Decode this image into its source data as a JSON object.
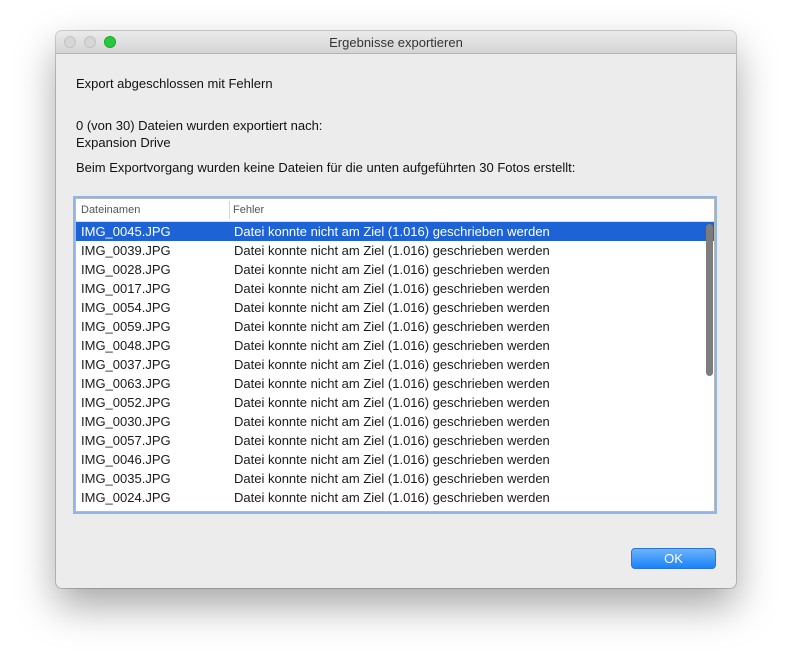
{
  "window": {
    "title": "Ergebnisse exportieren"
  },
  "message": {
    "heading": "Export abgeschlossen mit Fehlern",
    "summary_line1": "0 (von 30) Dateien wurden exportiert nach:",
    "summary_line2": "Expansion Drive",
    "detail": "Beim Exportvorgang wurden keine Dateien für die unten aufgeführten 30 Fotos erstellt:"
  },
  "table": {
    "columns": [
      "Dateinamen",
      "Fehler"
    ],
    "selected_row": 0,
    "rows": [
      {
        "file": "IMG_0045.JPG",
        "error": "Datei konnte nicht am Ziel (1.016) geschrieben werden"
      },
      {
        "file": "IMG_0039.JPG",
        "error": "Datei konnte nicht am Ziel (1.016) geschrieben werden"
      },
      {
        "file": "IMG_0028.JPG",
        "error": "Datei konnte nicht am Ziel (1.016) geschrieben werden"
      },
      {
        "file": "IMG_0017.JPG",
        "error": "Datei konnte nicht am Ziel (1.016) geschrieben werden"
      },
      {
        "file": "IMG_0054.JPG",
        "error": "Datei konnte nicht am Ziel (1.016) geschrieben werden"
      },
      {
        "file": "IMG_0059.JPG",
        "error": "Datei konnte nicht am Ziel (1.016) geschrieben werden"
      },
      {
        "file": "IMG_0048.JPG",
        "error": "Datei konnte nicht am Ziel (1.016) geschrieben werden"
      },
      {
        "file": "IMG_0037.JPG",
        "error": "Datei konnte nicht am Ziel (1.016) geschrieben werden"
      },
      {
        "file": "IMG_0063.JPG",
        "error": "Datei konnte nicht am Ziel (1.016) geschrieben werden"
      },
      {
        "file": "IMG_0052.JPG",
        "error": "Datei konnte nicht am Ziel (1.016) geschrieben werden"
      },
      {
        "file": "IMG_0030.JPG",
        "error": "Datei konnte nicht am Ziel (1.016) geschrieben werden"
      },
      {
        "file": "IMG_0057.JPG",
        "error": "Datei konnte nicht am Ziel (1.016) geschrieben werden"
      },
      {
        "file": "IMG_0046.JPG",
        "error": "Datei konnte nicht am Ziel (1.016) geschrieben werden"
      },
      {
        "file": "IMG_0035.JPG",
        "error": "Datei konnte nicht am Ziel (1.016) geschrieben werden"
      },
      {
        "file": "IMG_0024.JPG",
        "error": "Datei konnte nicht am Ziel (1.016) geschrieben werden"
      }
    ]
  },
  "buttons": {
    "ok_label": "OK"
  },
  "colors": {
    "selection": "#1e63d6",
    "ok_button": "#1a82fb",
    "focus_ring": "#8fb6e6"
  }
}
